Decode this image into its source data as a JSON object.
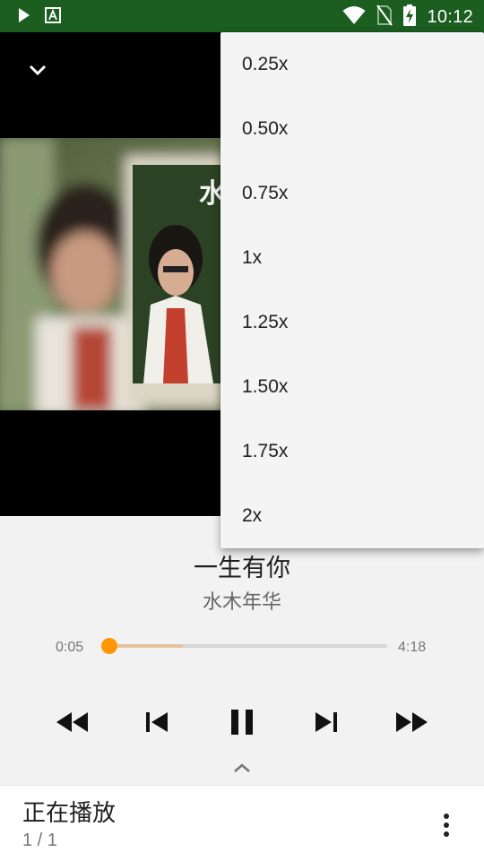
{
  "status_bar": {
    "time": "10:12",
    "icons": [
      "play-notification-icon",
      "font-a-icon",
      "wifi-icon",
      "no-sim-icon",
      "battery-charging-icon"
    ]
  },
  "player": {
    "collapse_icon": "chevron-down-icon",
    "track_title": "一生有你",
    "artist": "水木年华",
    "elapsed": "0:05",
    "duration": "4:18",
    "progress": 0.02,
    "buffered": 0.28,
    "accent_color": "#ff9800",
    "controls": [
      "rewind-icon",
      "skip-previous-icon",
      "pause-icon",
      "skip-next-icon",
      "fast-forward-icon"
    ]
  },
  "queue_bar": {
    "title": "正在播放",
    "count": "1 / 1"
  },
  "speed_menu": {
    "items": [
      "0.25x",
      "0.50x",
      "0.75x",
      "1x",
      "1.25x",
      "1.50x",
      "1.75x",
      "2x"
    ]
  }
}
